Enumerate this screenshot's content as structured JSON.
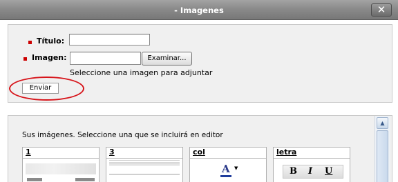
{
  "window": {
    "title": "- Imagenes",
    "close_icon": "close-icon"
  },
  "form": {
    "title_label": "Título:",
    "title_value": "",
    "image_label": "Imagen:",
    "image_value": "",
    "browse_label": "Examinar...",
    "hint": "Seleccione una imagen para adjuntar",
    "send_label": "Enviar",
    "required_color": "#cc0000",
    "highlight_color": "#d7151b"
  },
  "gallery": {
    "caption": "Sus imágenes. Seleccione una que se incluirá en editor",
    "items": [
      {
        "label": "1"
      },
      {
        "label": "3"
      },
      {
        "label": "col"
      },
      {
        "label": "letra"
      }
    ],
    "letra_buttons": [
      "B",
      "I",
      "U"
    ],
    "col_glyph": "A"
  }
}
